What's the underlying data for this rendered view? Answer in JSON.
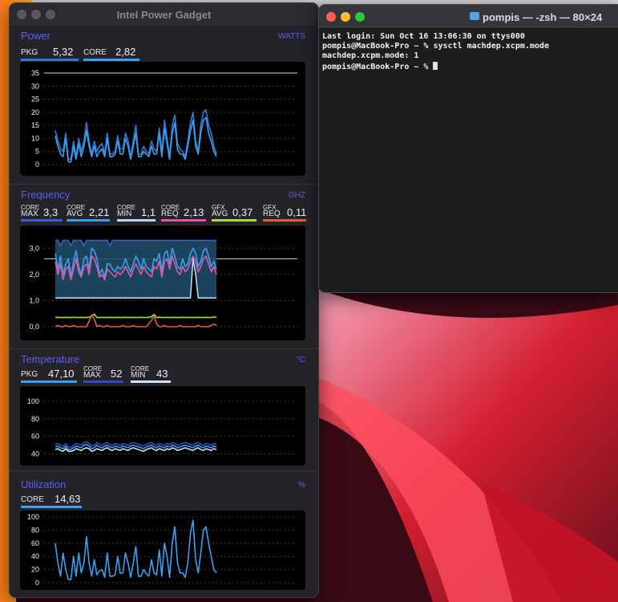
{
  "colors": {
    "accent": "#5b5df6",
    "pkg_power": "#2e7bd6",
    "core_power": "#3a9ff0",
    "core_max": "#3a5ed6",
    "core_avg": "#3aa0f0",
    "core_min": "#b8d6f4",
    "core_req": "#e05aa8",
    "gfx_avg": "#a6e03a",
    "gfx_req": "#e0603a",
    "temp_pkg": "#3aa0f0",
    "temp_core_max": "#2a4fc8",
    "temp_core_min": "#c8e4f8",
    "util_core": "#3aa0f0"
  },
  "gadget": {
    "title": "Intel Power Gadget",
    "power": {
      "title": "Power",
      "unit": "WATTS",
      "metrics": [
        {
          "label": "PKG",
          "value": "5,32"
        },
        {
          "label": "CORE",
          "value": "2,82"
        }
      ]
    },
    "frequency": {
      "title": "Frequency",
      "unit": "GHZ",
      "metrics": [
        {
          "label_top": "CORE",
          "label_bottom": "MAX",
          "value": "3,3"
        },
        {
          "label_top": "CORE",
          "label_bottom": "AVG",
          "value": "2,21"
        },
        {
          "label_top": "CORE",
          "label_bottom": "MIN",
          "value": "1,1"
        },
        {
          "label_top": "CORE",
          "label_bottom": "REQ",
          "value": "2,13"
        },
        {
          "label_top": "GFX",
          "label_bottom": "AVG",
          "value": "0,37"
        },
        {
          "label_top": "GFX",
          "label_bottom": "REQ",
          "value": "0,11"
        }
      ]
    },
    "temperature": {
      "title": "Temperature",
      "unit": "°C",
      "metrics": [
        {
          "label": "PKG",
          "value": "47,10"
        },
        {
          "label_top": "CORE",
          "label_bottom": "MAX",
          "value": "52"
        },
        {
          "label_top": "CORE",
          "label_bottom": "MIN",
          "value": "43"
        }
      ]
    },
    "utilization": {
      "title": "Utilization",
      "unit": "%",
      "metrics": [
        {
          "label": "CORE",
          "value": "14,63"
        }
      ]
    }
  },
  "chart_data": [
    {
      "type": "line",
      "ylim": [
        0,
        35
      ],
      "yticks": [
        "35",
        "30",
        "25",
        "20",
        "15",
        "10",
        "5",
        "0"
      ],
      "reference_line": 35,
      "series": [
        {
          "name": "PKG",
          "values": [
            13,
            9,
            6,
            5,
            12,
            2,
            2,
            9,
            3,
            10,
            5,
            9,
            16,
            9,
            4,
            9,
            5,
            7,
            8,
            4,
            12,
            4,
            4,
            5,
            11,
            6,
            6,
            12,
            9,
            3,
            9,
            15,
            4,
            4,
            7,
            5,
            4,
            9,
            6,
            5,
            14,
            4,
            17,
            10,
            3,
            15,
            19,
            8,
            6,
            5,
            3,
            9,
            16,
            20,
            9,
            5,
            15,
            20,
            21,
            15,
            12,
            7,
            4
          ]
        },
        {
          "name": "CORE",
          "values": [
            11,
            7,
            4,
            3,
            10,
            1,
            1,
            7,
            2,
            8,
            3,
            7,
            13,
            7,
            3,
            7,
            3,
            5,
            6,
            3,
            10,
            3,
            3,
            4,
            9,
            4,
            4,
            10,
            7,
            2,
            7,
            12,
            3,
            3,
            5,
            4,
            3,
            7,
            4,
            4,
            12,
            3,
            14,
            8,
            2,
            12,
            16,
            6,
            4,
            4,
            2,
            7,
            13,
            17,
            7,
            4,
            12,
            17,
            18,
            12,
            9,
            5,
            3
          ]
        }
      ]
    },
    {
      "type": "area",
      "ylim": [
        0,
        3.5
      ],
      "yticks": [
        "3,0",
        "2,0",
        "1,0",
        "0,0"
      ],
      "reference_line": 2.6,
      "series": [
        {
          "name": "CORE MAX",
          "values": [
            3.3,
            3.3,
            3.1,
            3.3,
            3.3,
            3.3,
            3.1,
            3.3,
            3.3,
            3.3,
            3.3,
            3.1,
            3.3,
            3.3,
            3.3,
            3.3,
            3.3,
            3.3,
            3.3,
            3.3,
            3.3,
            3.1,
            3.3,
            3.3,
            3.3,
            3.3,
            3.3,
            3.3,
            3.3,
            3.3,
            3.3,
            3.3,
            3.3,
            3.3,
            3.3,
            3.3,
            3.3,
            3.3,
            3.3,
            3.3,
            3.3,
            3.3,
            3.3,
            3.3,
            3.3,
            3.3,
            3.3,
            3.3,
            3.3,
            3.3,
            3.3,
            3.3,
            3.3,
            3.3,
            3.3,
            3.3,
            3.3,
            3.3,
            3.3,
            3.3,
            3.3,
            3.3,
            3.3
          ]
        },
        {
          "name": "CORE MIN",
          "values": [
            1.1,
            1.1,
            1.1,
            1.1,
            1.1,
            1.1,
            1.1,
            1.1,
            1.1,
            1.1,
            1.1,
            1.1,
            1.1,
            1.1,
            1.1,
            1.1,
            1.1,
            1.1,
            1.1,
            1.1,
            1.1,
            1.1,
            1.1,
            1.1,
            1.1,
            1.1,
            1.1,
            1.1,
            1.1,
            1.1,
            1.1,
            1.1,
            1.1,
            1.1,
            1.1,
            1.1,
            1.1,
            1.1,
            1.1,
            1.1,
            1.1,
            1.1,
            1.1,
            1.1,
            1.1,
            1.1,
            1.1,
            1.1,
            1.1,
            1.1,
            1.1,
            1.1,
            1.1,
            2.6,
            2.0,
            1.1,
            1.1,
            1.1,
            1.1,
            1.1,
            1.1,
            1.1,
            1.1
          ]
        },
        {
          "name": "CORE AVG",
          "values": [
            2.8,
            2.2,
            2.7,
            2.0,
            2.4,
            2.6,
            1.9,
            2.5,
            2.9,
            2.3,
            2.0,
            2.6,
            2.7,
            2.2,
            3.0,
            2.9,
            2.6,
            2.0,
            2.2,
            1.9,
            2.4,
            2.4,
            2.2,
            2.1,
            2.3,
            2.2,
            2.3,
            2.6,
            2.3,
            2.1,
            2.4,
            2.7,
            2.5,
            2.2,
            2.6,
            2.3,
            2.2,
            2.1,
            2.6,
            2.5,
            2.8,
            2.1,
            2.8,
            2.9,
            2.4,
            3.0,
            2.7,
            2.3,
            2.2,
            2.6,
            2.3,
            2.4,
            2.8,
            3.0,
            2.8,
            2.3,
            2.5,
            2.9,
            3.0,
            2.7,
            2.3,
            2.5,
            2.2
          ]
        },
        {
          "name": "CORE REQ",
          "values": [
            2.5,
            2.0,
            2.4,
            1.8,
            2.2,
            2.3,
            1.8,
            2.2,
            2.6,
            2.1,
            1.9,
            2.3,
            2.4,
            2.0,
            2.7,
            2.6,
            2.3,
            1.9,
            2.0,
            1.8,
            2.2,
            2.1,
            2.0,
            1.9,
            2.1,
            2.0,
            2.1,
            2.3,
            2.1,
            1.9,
            2.2,
            2.4,
            2.2,
            2.0,
            2.3,
            2.1,
            2.0,
            1.9,
            2.3,
            2.2,
            2.5,
            1.9,
            2.5,
            2.6,
            2.2,
            2.7,
            2.4,
            2.1,
            2.0,
            2.3,
            2.1,
            2.2,
            2.5,
            2.7,
            2.5,
            2.1,
            2.3,
            2.6,
            2.7,
            2.4,
            2.1,
            2.3,
            2.0
          ]
        },
        {
          "name": "GFX AVG",
          "values": [
            0.35,
            0.36,
            0.35,
            0.35,
            0.36,
            0.35,
            0.35,
            0.36,
            0.35,
            0.35,
            0.36,
            0.35,
            0.35,
            0.36,
            0.4,
            0.48,
            0.35,
            0.35,
            0.36,
            0.35,
            0.35,
            0.36,
            0.35,
            0.35,
            0.36,
            0.35,
            0.35,
            0.36,
            0.35,
            0.35,
            0.36,
            0.35,
            0.35,
            0.36,
            0.35,
            0.35,
            0.36,
            0.38,
            0.47,
            0.35,
            0.36,
            0.35,
            0.35,
            0.36,
            0.35,
            0.35,
            0.36,
            0.35,
            0.35,
            0.36,
            0.35,
            0.35,
            0.36,
            0.35,
            0.35,
            0.36,
            0.35,
            0.35,
            0.36,
            0.35,
            0.35,
            0.37,
            0.36
          ]
        },
        {
          "name": "GFX REQ",
          "values": [
            0,
            0.05,
            0,
            0,
            0.05,
            0,
            0,
            0.05,
            0,
            0,
            0,
            0,
            0,
            0.2,
            0.45,
            0.3,
            0,
            0.05,
            0,
            0,
            0.05,
            0,
            0,
            0,
            0,
            0,
            0.05,
            0,
            0,
            0,
            0.05,
            0,
            0,
            0,
            0,
            0,
            0.1,
            0.25,
            0.4,
            0.1,
            0,
            0,
            0.05,
            0,
            0,
            0,
            0,
            0,
            0.05,
            0,
            0,
            0,
            0,
            0,
            0,
            0.05,
            0,
            0,
            0,
            0,
            0.05,
            0.1,
            0.05
          ]
        }
      ]
    },
    {
      "type": "line",
      "ylim": [
        35,
        110
      ],
      "yticks": [
        "100",
        "80",
        "60",
        "40"
      ],
      "series": [
        {
          "name": "CORE MAX",
          "values": [
            51,
            52,
            50,
            49,
            52,
            48,
            47,
            50,
            52,
            51,
            50,
            53,
            54,
            52,
            49,
            50,
            53,
            51,
            50,
            52,
            53,
            51,
            50,
            52,
            51,
            50,
            52,
            51,
            50,
            52,
            53,
            52,
            51,
            50,
            49,
            51,
            52,
            53,
            51,
            50,
            52,
            51,
            50,
            52,
            51,
            53,
            52,
            50,
            51,
            52,
            53,
            52,
            51,
            50,
            52,
            53,
            51,
            50,
            52,
            51,
            50,
            52,
            51
          ]
        },
        {
          "name": "CORE MIN",
          "values": [
            45,
            46,
            44,
            43,
            46,
            43,
            43,
            44,
            46,
            45,
            44,
            46,
            47,
            46,
            43,
            44,
            46,
            45,
            44,
            46,
            47,
            45,
            44,
            46,
            45,
            44,
            46,
            45,
            44,
            46,
            47,
            46,
            45,
            44,
            43,
            45,
            46,
            47,
            45,
            44,
            46,
            45,
            44,
            46,
            45,
            47,
            46,
            44,
            45,
            46,
            47,
            46,
            45,
            44,
            46,
            47,
            45,
            44,
            46,
            45,
            44,
            46,
            45
          ]
        },
        {
          "name": "PKG",
          "values": [
            48,
            49,
            47,
            46,
            49,
            45,
            45,
            47,
            49,
            48,
            47,
            50,
            51,
            49,
            46,
            47,
            50,
            48,
            47,
            49,
            50,
            48,
            47,
            49,
            48,
            47,
            49,
            48,
            47,
            49,
            50,
            49,
            48,
            47,
            46,
            48,
            49,
            50,
            48,
            47,
            49,
            48,
            47,
            49,
            48,
            50,
            49,
            47,
            48,
            49,
            50,
            49,
            48,
            47,
            49,
            50,
            48,
            47,
            49,
            48,
            47,
            49,
            48
          ]
        }
      ]
    },
    {
      "type": "line",
      "ylim": [
        0,
        100
      ],
      "yticks": [
        "100",
        "80",
        "60",
        "40",
        "20",
        "0"
      ],
      "series": [
        {
          "name": "CORE",
          "values": [
            60,
            30,
            10,
            45,
            20,
            5,
            5,
            40,
            10,
            45,
            15,
            30,
            70,
            30,
            10,
            35,
            12,
            18,
            20,
            8,
            45,
            10,
            10,
            12,
            40,
            14,
            15,
            45,
            30,
            8,
            30,
            55,
            10,
            10,
            20,
            14,
            10,
            35,
            15,
            12,
            50,
            10,
            60,
            40,
            8,
            60,
            85,
            30,
            15,
            15,
            8,
            30,
            75,
            95,
            35,
            15,
            45,
            80,
            85,
            60,
            40,
            20,
            15
          ]
        }
      ]
    }
  ],
  "terminal": {
    "title": "pompis — -zsh — 80×24",
    "lines": [
      "Last login: Sun Oct 16 13:06:30 on ttys000",
      "pompis@MacBook-Pro ~ % sysctl machdep.xcpm.mode",
      "machdep.xcpm.mode: 1",
      "pompis@MacBook-Pro ~ % "
    ]
  }
}
